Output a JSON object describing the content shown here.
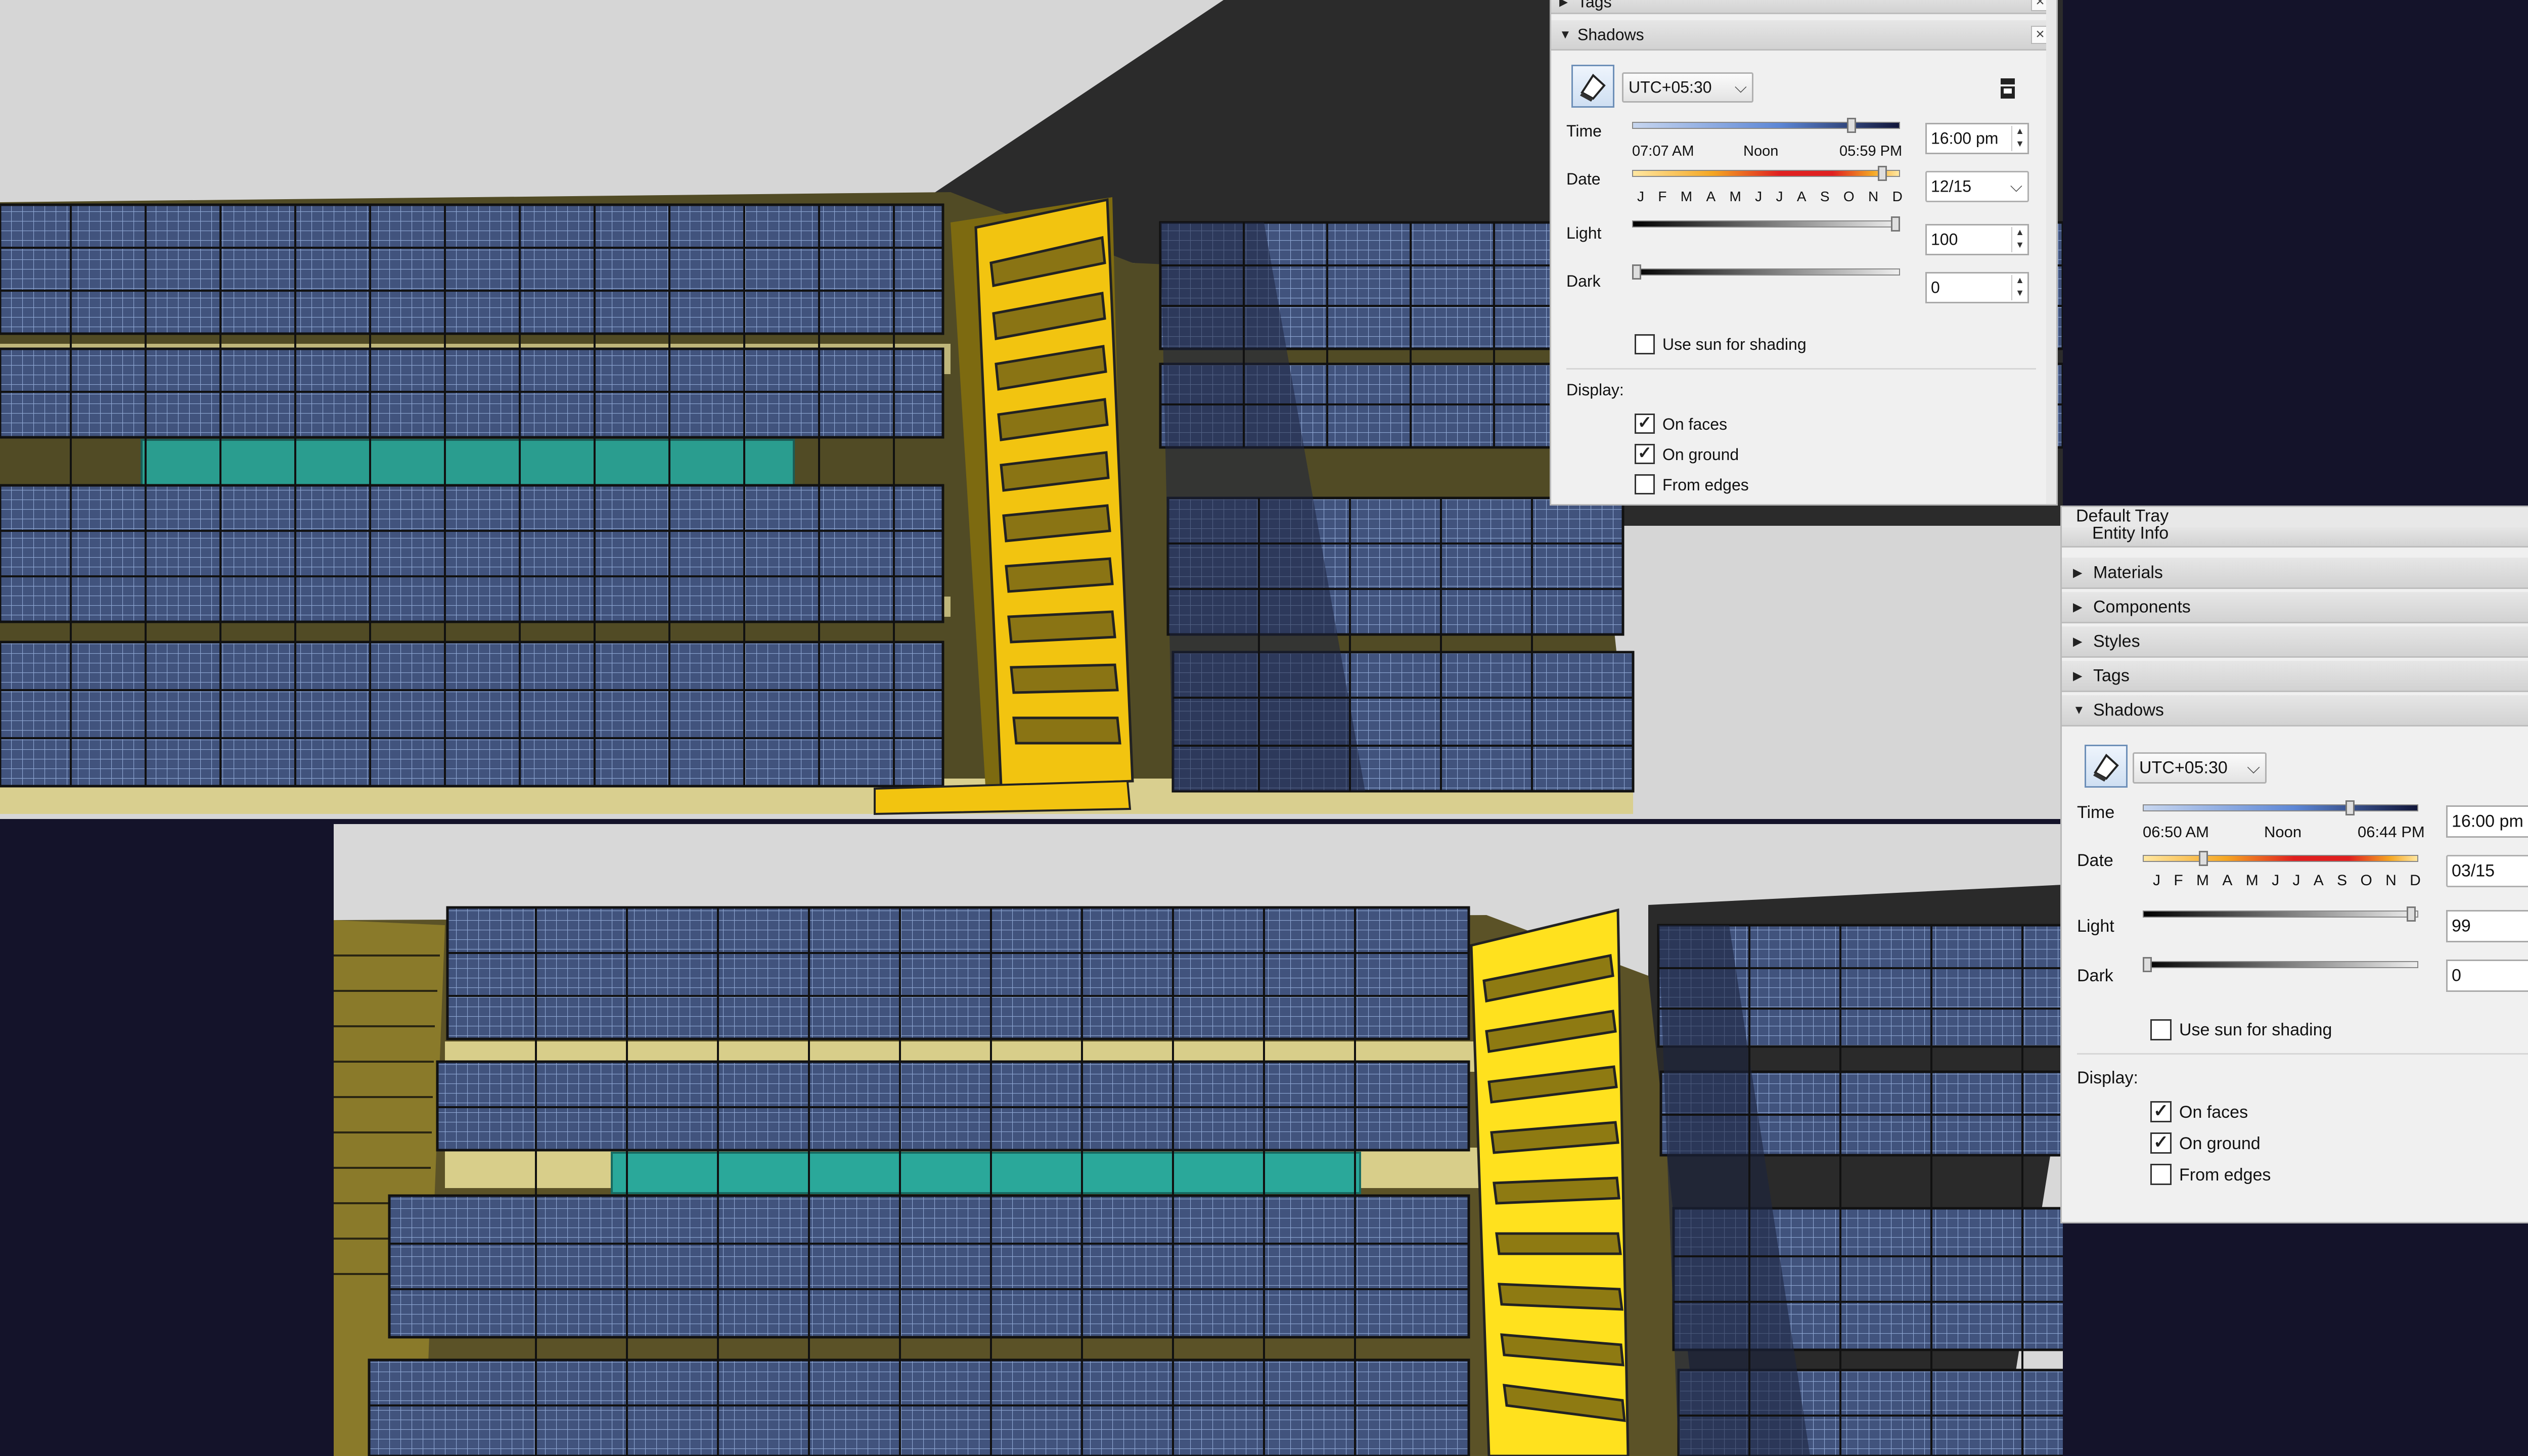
{
  "colors": {
    "navy_bg": "#14132a",
    "sky_gray": "#d7d7d7",
    "panel_blue": "#42547e",
    "panel_grid": "#8aa3cf",
    "stair_yellow": "#f1c40f",
    "stair_yellow_bright": "#ffe21f",
    "teal": "#2a9d8f",
    "olive_roof": "#5b5227",
    "tray_bg": "#f0f0f0"
  },
  "top_tray": {
    "tags_label": "Tags",
    "shadows_label": "Shadows",
    "close_glyph": "×",
    "timezone": "UTC+05:30",
    "time_label": "Time",
    "time_start": "07:07 AM",
    "time_noon": "Noon",
    "time_end": "05:59 PM",
    "time_value": "16:00 pm",
    "time_position": 0.83,
    "date_label": "Date",
    "months": [
      "J",
      "F",
      "M",
      "A",
      "M",
      "J",
      "J",
      "A",
      "S",
      "O",
      "N",
      "D"
    ],
    "date_value": "12/15",
    "date_position": 0.95,
    "light_label": "Light",
    "light_value": "100",
    "light_position": 1.0,
    "dark_label": "Dark",
    "dark_value": "0",
    "dark_position": 0.0,
    "use_sun_label": "Use sun for shading",
    "use_sun_checked": false,
    "display_label": "Display:",
    "on_faces_label": "On faces",
    "on_faces_checked": true,
    "on_ground_label": "On ground",
    "on_ground_checked": true,
    "from_edges_label": "From edges",
    "from_edges_checked": false
  },
  "bottom_tray": {
    "tray_title": "Default Tray",
    "entity_info_label": "Entity Info",
    "materials_label": "Materials",
    "components_label": "Components",
    "styles_label": "Styles",
    "tags_label": "Tags",
    "shadows_label": "Shadows",
    "close_glyph": "×",
    "timezone": "UTC+05:30",
    "time_label": "Time",
    "time_start": "06:50 AM",
    "time_noon": "Noon",
    "time_end": "06:44 PM",
    "time_value": "16:00 pm",
    "time_position": 0.76,
    "date_label": "Date",
    "months": [
      "J",
      "F",
      "M",
      "A",
      "M",
      "J",
      "J",
      "A",
      "S",
      "O",
      "N",
      "D"
    ],
    "date_value": "03/15",
    "date_position": 0.21,
    "light_label": "Light",
    "light_value": "99",
    "light_position": 0.99,
    "dark_label": "Dark",
    "dark_value": "0",
    "dark_position": 0.0,
    "use_sun_label": "Use sun for shading",
    "use_sun_checked": false,
    "display_label": "Display:",
    "on_faces_label": "On faces",
    "on_faces_checked": true,
    "on_ground_label": "On ground",
    "on_ground_checked": true,
    "from_edges_label": "From edges",
    "from_edges_checked": false
  },
  "icons": {
    "expanded": "▼",
    "collapsed": "▶",
    "dropdown": "⌵",
    "spin_up": "▲",
    "spin_down": "▼",
    "check": "✓"
  }
}
